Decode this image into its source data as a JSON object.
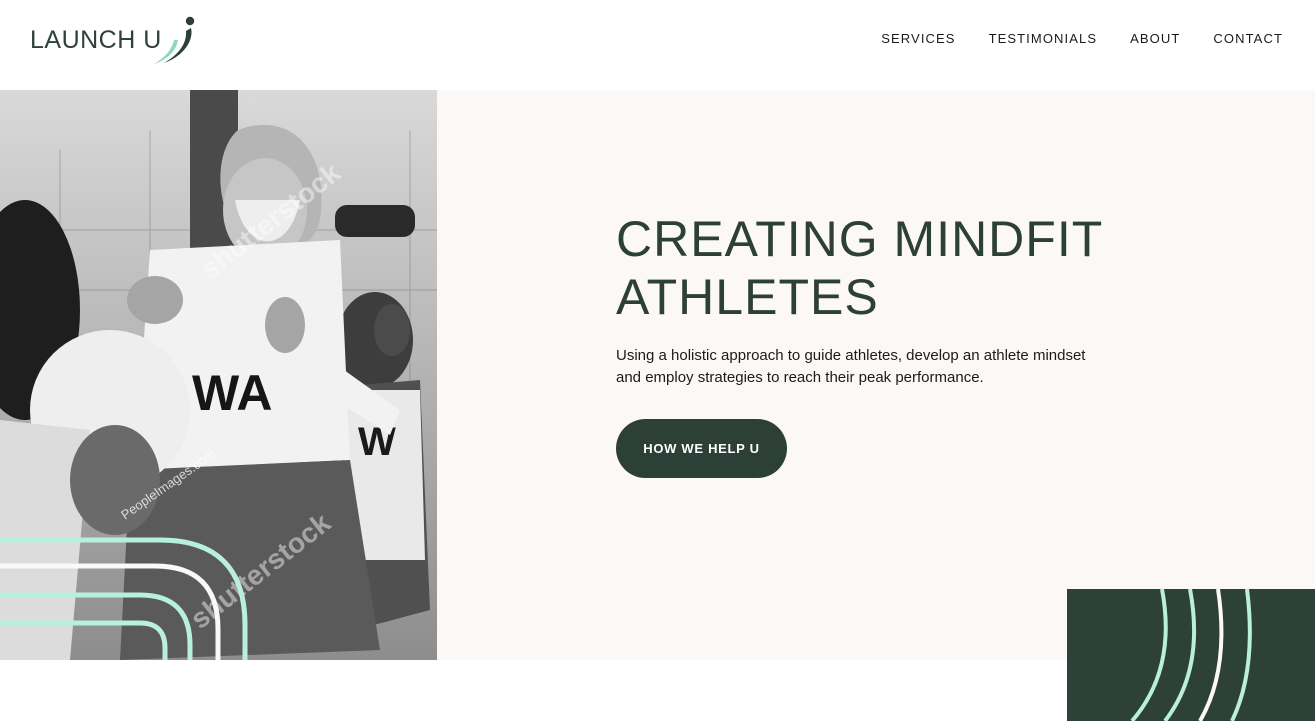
{
  "brand": {
    "logo_text": "LAUNCH U",
    "accent_color": "#2d4038",
    "mint_color": "#b9f0dc",
    "cream_color": "#fcf8f5"
  },
  "nav": {
    "items": [
      {
        "label": "SERVICES"
      },
      {
        "label": "TESTIMONIALS"
      },
      {
        "label": "ABOUT"
      },
      {
        "label": "CONTACT"
      }
    ]
  },
  "hero": {
    "title": "CREATING MINDFIT ATHLETES",
    "subtitle_line1": "Using a holistic approach to guide athletes, develop an athlete mindset",
    "subtitle_line2": "and employ strategies to reach their peak performance.",
    "cta_label": "HOW WE HELP U",
    "photo": {
      "jersey_label_1": "WA",
      "jersey_label_2": "W",
      "watermark": "shutterstock",
      "credit": "PeopleImages.com"
    }
  }
}
